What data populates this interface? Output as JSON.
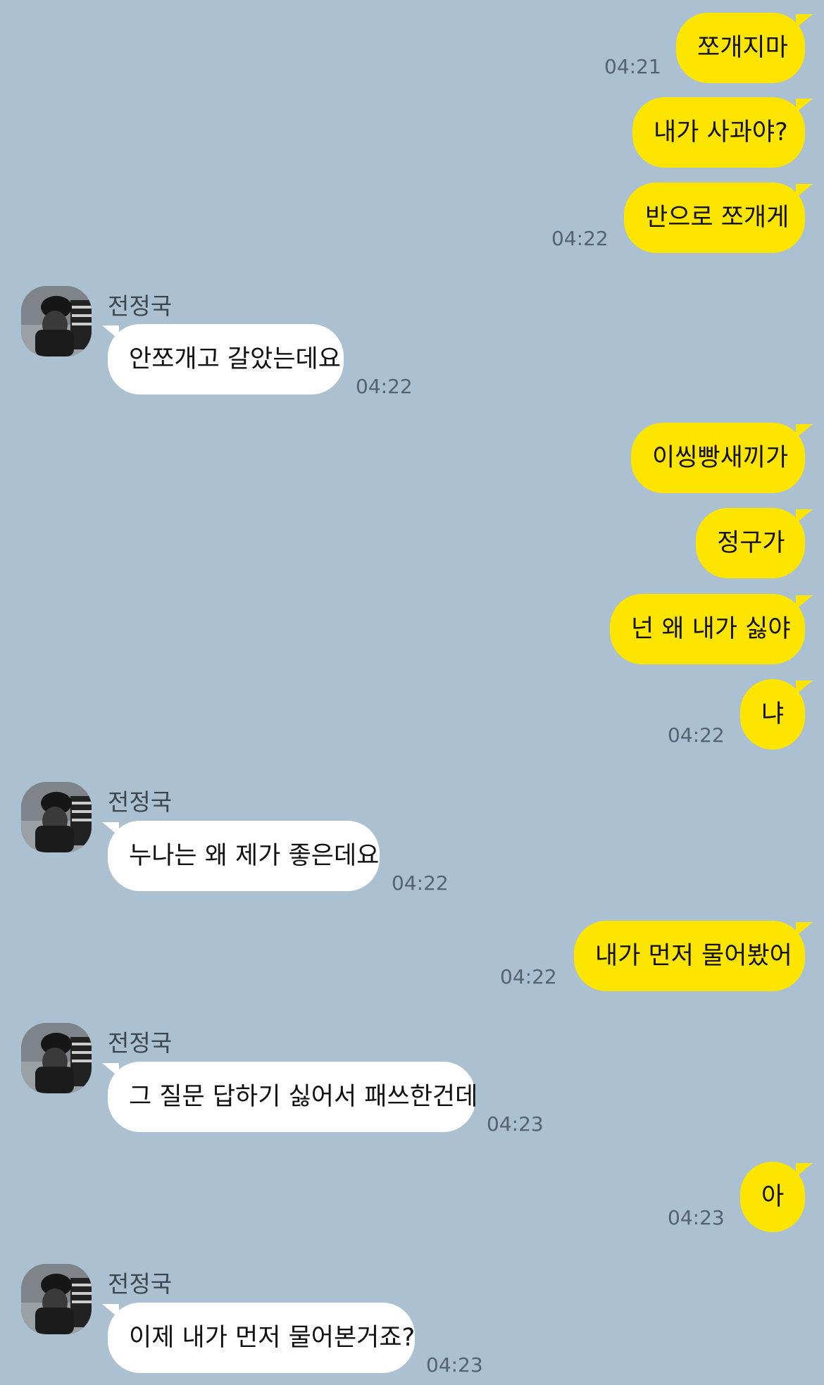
{
  "contact": {
    "name": "전정국"
  },
  "messages": [
    {
      "id": 1,
      "sender": "me",
      "text": "쪼개지마",
      "time": "04:21"
    },
    {
      "id": 2,
      "sender": "me",
      "text": "내가 사과야?",
      "time": ""
    },
    {
      "id": 3,
      "sender": "me",
      "text": "반으로 쪼개게",
      "time": "04:22"
    },
    {
      "id": 4,
      "sender": "them",
      "text": "안쪼개고 갈았는데요",
      "time": "04:22"
    },
    {
      "id": 5,
      "sender": "me",
      "text": "이씽빵새끼가",
      "time": ""
    },
    {
      "id": 6,
      "sender": "me",
      "text": "정구가",
      "time": ""
    },
    {
      "id": 7,
      "sender": "me",
      "text": "넌 왜 내가 싫야",
      "time": ""
    },
    {
      "id": 8,
      "sender": "me",
      "text": "냐",
      "time": "04:22"
    },
    {
      "id": 9,
      "sender": "them",
      "text": "누나는 왜 제가 좋은데요",
      "time": "04:22"
    },
    {
      "id": 10,
      "sender": "me",
      "text": "내가 먼저 물어봤어",
      "time": "04:22"
    },
    {
      "id": 11,
      "sender": "them",
      "text": "그 질문 답하기 싫어서 패쓰한건데",
      "time": "04:23"
    },
    {
      "id": 12,
      "sender": "me",
      "text": "아",
      "time": "04:23"
    },
    {
      "id": 13,
      "sender": "them",
      "text": "이제 내가 먼저 물어본거죠?",
      "time": "04:23"
    }
  ],
  "colors": {
    "background": "#abc1d1",
    "my_bubble": "#fee500",
    "their_bubble": "#ffffff"
  }
}
